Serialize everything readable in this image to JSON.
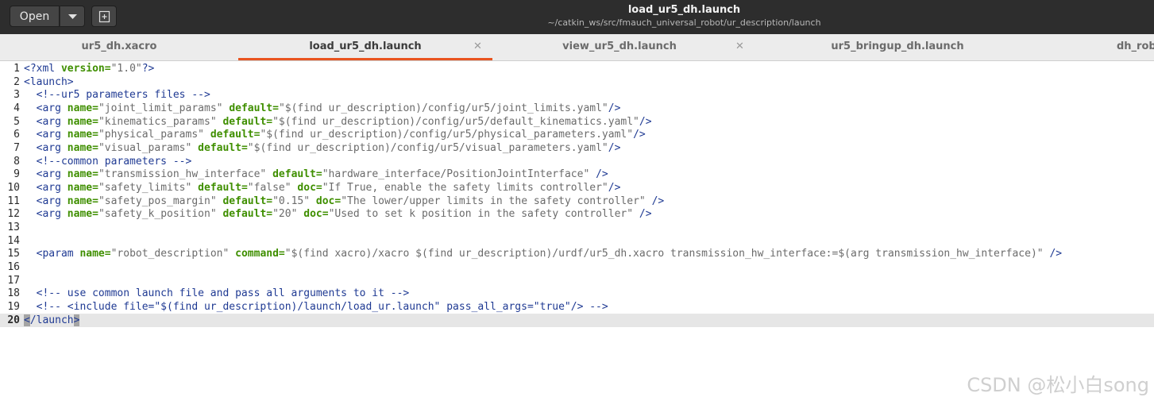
{
  "header": {
    "open_label": "Open",
    "title": "load_ur5_dh.launch",
    "path": "~/catkin_ws/src/fmauch_universal_robot/ur_description/launch"
  },
  "tabs": [
    {
      "label": "ur5_dh.xacro"
    },
    {
      "label": "load_ur5_dh.launch"
    },
    {
      "label": "view_ur5_dh.launch"
    },
    {
      "label": "ur5_bringup_dh.launch"
    },
    {
      "label": "dh_rob"
    }
  ],
  "editor": {
    "line_numbers": [
      "1",
      "2",
      "3",
      "4",
      "5",
      "6",
      "7",
      "8",
      "9",
      "10",
      "11",
      "12",
      "13",
      "14",
      "15",
      "16",
      "17",
      "18",
      "19",
      "20"
    ],
    "current_line": "20",
    "lines": {
      "l1": {
        "a": "<?xml ",
        "b": "version=",
        "c": "\"1.0\"",
        "d": "?>"
      },
      "l2": {
        "a": "<launch>"
      },
      "l3": {
        "a": "  <!--ur5 parameters files -->"
      },
      "l4": {
        "a": "  <arg ",
        "b": "name=",
        "c": "\"joint_limit_params\" ",
        "d": "default=",
        "e": "\"$(find ur_description)/config/ur5/joint_limits.yaml\"",
        "f": "/>"
      },
      "l5": {
        "a": "  <arg ",
        "b": "name=",
        "c": "\"kinematics_params\" ",
        "d": "default=",
        "e": "\"$(find ur_description)/config/ur5/default_kinematics.yaml\"",
        "f": "/>"
      },
      "l6": {
        "a": "  <arg ",
        "b": "name=",
        "c": "\"physical_params\" ",
        "d": "default=",
        "e": "\"$(find ur_description)/config/ur5/physical_parameters.yaml\"",
        "f": "/>"
      },
      "l7": {
        "a": "  <arg ",
        "b": "name=",
        "c": "\"visual_params\" ",
        "d": "default=",
        "e": "\"$(find ur_description)/config/ur5/visual_parameters.yaml\"",
        "f": "/>"
      },
      "l8": {
        "a": "  <!--common parameters -->"
      },
      "l9": {
        "a": "  <arg ",
        "b": "name=",
        "c": "\"transmission_hw_interface\" ",
        "d": "default=",
        "e": "\"hardware_interface/PositionJointInterface\" ",
        "f": "/>"
      },
      "l10": {
        "a": "  <arg ",
        "b": "name=",
        "c": "\"safety_limits\" ",
        "d": "default=",
        "e": "\"false\" ",
        "f": "doc=",
        "g": "\"If True, enable the safety limits controller\"",
        "h": "/>"
      },
      "l11": {
        "a": "  <arg ",
        "b": "name=",
        "c": "\"safety_pos_margin\" ",
        "d": "default=",
        "e": "\"0.15\" ",
        "f": "doc=",
        "g": "\"The lower/upper limits in the safety controller\" ",
        "h": "/>"
      },
      "l12": {
        "a": "  <arg ",
        "b": "name=",
        "c": "\"safety_k_position\" ",
        "d": "default=",
        "e": "\"20\" ",
        "f": "doc=",
        "g": "\"Used to set k position in the safety controller\" ",
        "h": "/>"
      },
      "l15": {
        "a": "  <param ",
        "b": "name=",
        "c": "\"robot_description\" ",
        "d": "command=",
        "e": "\"$(find xacro)/xacro $(find ur_description)/urdf/ur5_dh.xacro transmission_hw_interface:=$(arg transmission_hw_interface)\" ",
        "f": "/>"
      },
      "l18": {
        "a": "  <!-- use common launch file and pass all arguments to it -->"
      },
      "l19": {
        "a": "  <!-- <include file=\"$(find ur_description)/launch/load_ur.launch\" pass_all_args=\"true\"/> -->"
      },
      "l20": {
        "a": "<",
        "b": "/launch",
        "c": ">"
      }
    }
  },
  "watermark": "CSDN @松小白song"
}
